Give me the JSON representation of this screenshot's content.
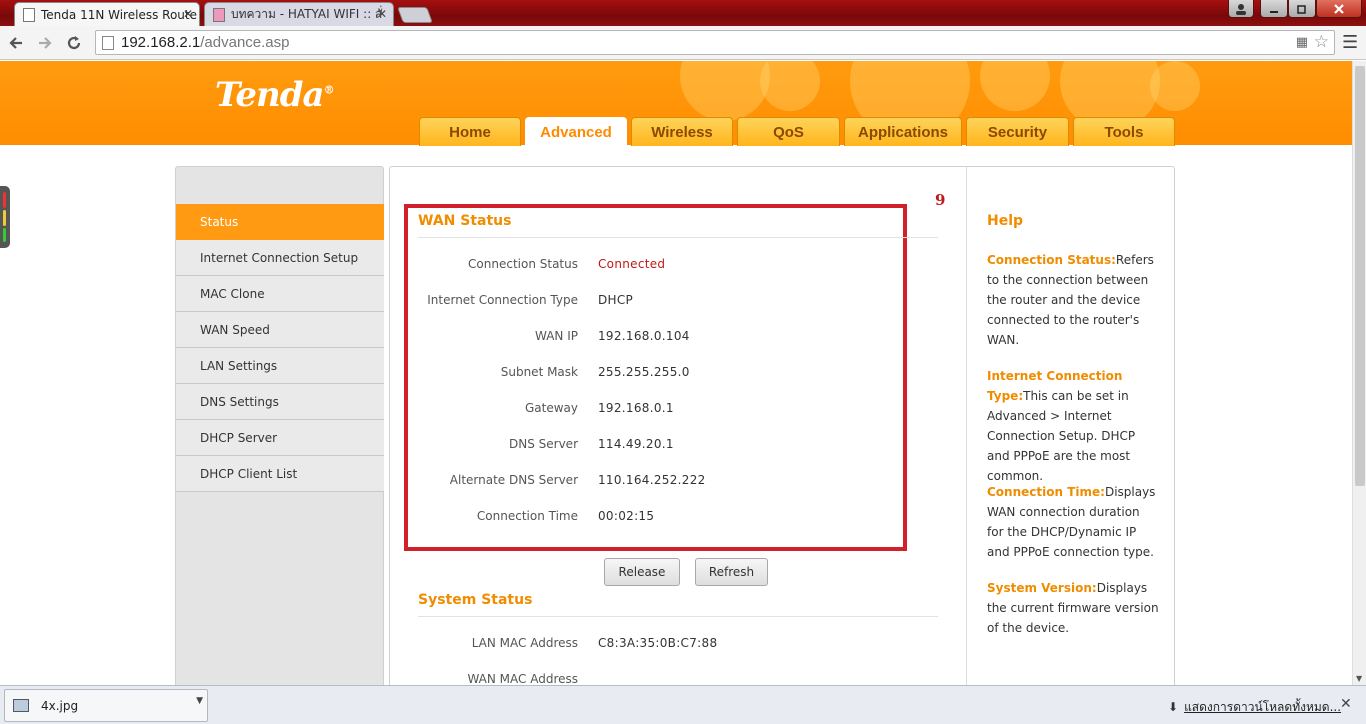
{
  "browser": {
    "tabs": [
      {
        "title": "Tenda 11N Wireless Route",
        "active": true
      },
      {
        "title": "บทความ - HATYAI WIFI :: สั่",
        "active": false
      }
    ],
    "url_host": "192.168.2.1",
    "url_path": "/advance.asp",
    "window_controls": [
      "minimize-icon",
      "restore-icon",
      "close-icon"
    ]
  },
  "header": {
    "logo": "Tenda",
    "logo_mark": "®",
    "nav_tabs": [
      "Home",
      "Advanced",
      "Wireless",
      "QoS",
      "Applications",
      "Security",
      "Tools"
    ],
    "active_tab": "Advanced"
  },
  "sidebar": {
    "items": [
      "Status",
      "Internet Connection Setup",
      "MAC Clone",
      "WAN Speed",
      "LAN Settings",
      "DNS Settings",
      "DHCP Server",
      "DHCP Client List"
    ],
    "active": "Status"
  },
  "annotation_number": "9",
  "wan_status": {
    "title": "WAN Status",
    "rows": [
      {
        "label": "Connection Status",
        "value": "Connected"
      },
      {
        "label": "Internet Connection Type",
        "value": "DHCP"
      },
      {
        "label": "WAN IP",
        "value": "192.168.0.104"
      },
      {
        "label": "Subnet Mask",
        "value": "255.255.255.0"
      },
      {
        "label": "Gateway",
        "value": "192.168.0.1"
      },
      {
        "label": "DNS Server",
        "value": "114.49.20.1"
      },
      {
        "label": "Alternate DNS Server",
        "value": "110.164.252.222"
      },
      {
        "label": "Connection Time",
        "value": "00:02:15"
      }
    ],
    "release_label": "Release",
    "refresh_label": "Refresh"
  },
  "system_status": {
    "title": "System Status",
    "rows": [
      {
        "label": "LAN MAC Address",
        "value": "C8:3A:35:0B:C7:88"
      },
      {
        "label": "WAN MAC Address",
        "value": ""
      }
    ]
  },
  "help": {
    "title": "Help",
    "entries": [
      {
        "term": "Connection Status:",
        "text": "Refers to the connection between the router and the device connected to the router's WAN."
      },
      {
        "term": "Internet Connection Type:",
        "text": "This can be set in Advanced > Internet Connection Setup. DHCP and PPPoE are the most common."
      },
      {
        "term": "Connection Time:",
        "text": "Displays WAN connection duration for the DHCP/Dynamic IP and PPPoE connection type."
      },
      {
        "term": "System Version:",
        "text": "Displays the current firmware version of the device."
      }
    ]
  },
  "download_bar": {
    "file_name": "4x.jpg",
    "show_all": "แสดงการดาวน์โหลดทั้งหมด..."
  },
  "colors": {
    "brand_orange": "#ff8d00",
    "highlight_red": "#d0202a",
    "connected_red": "#c01818"
  }
}
